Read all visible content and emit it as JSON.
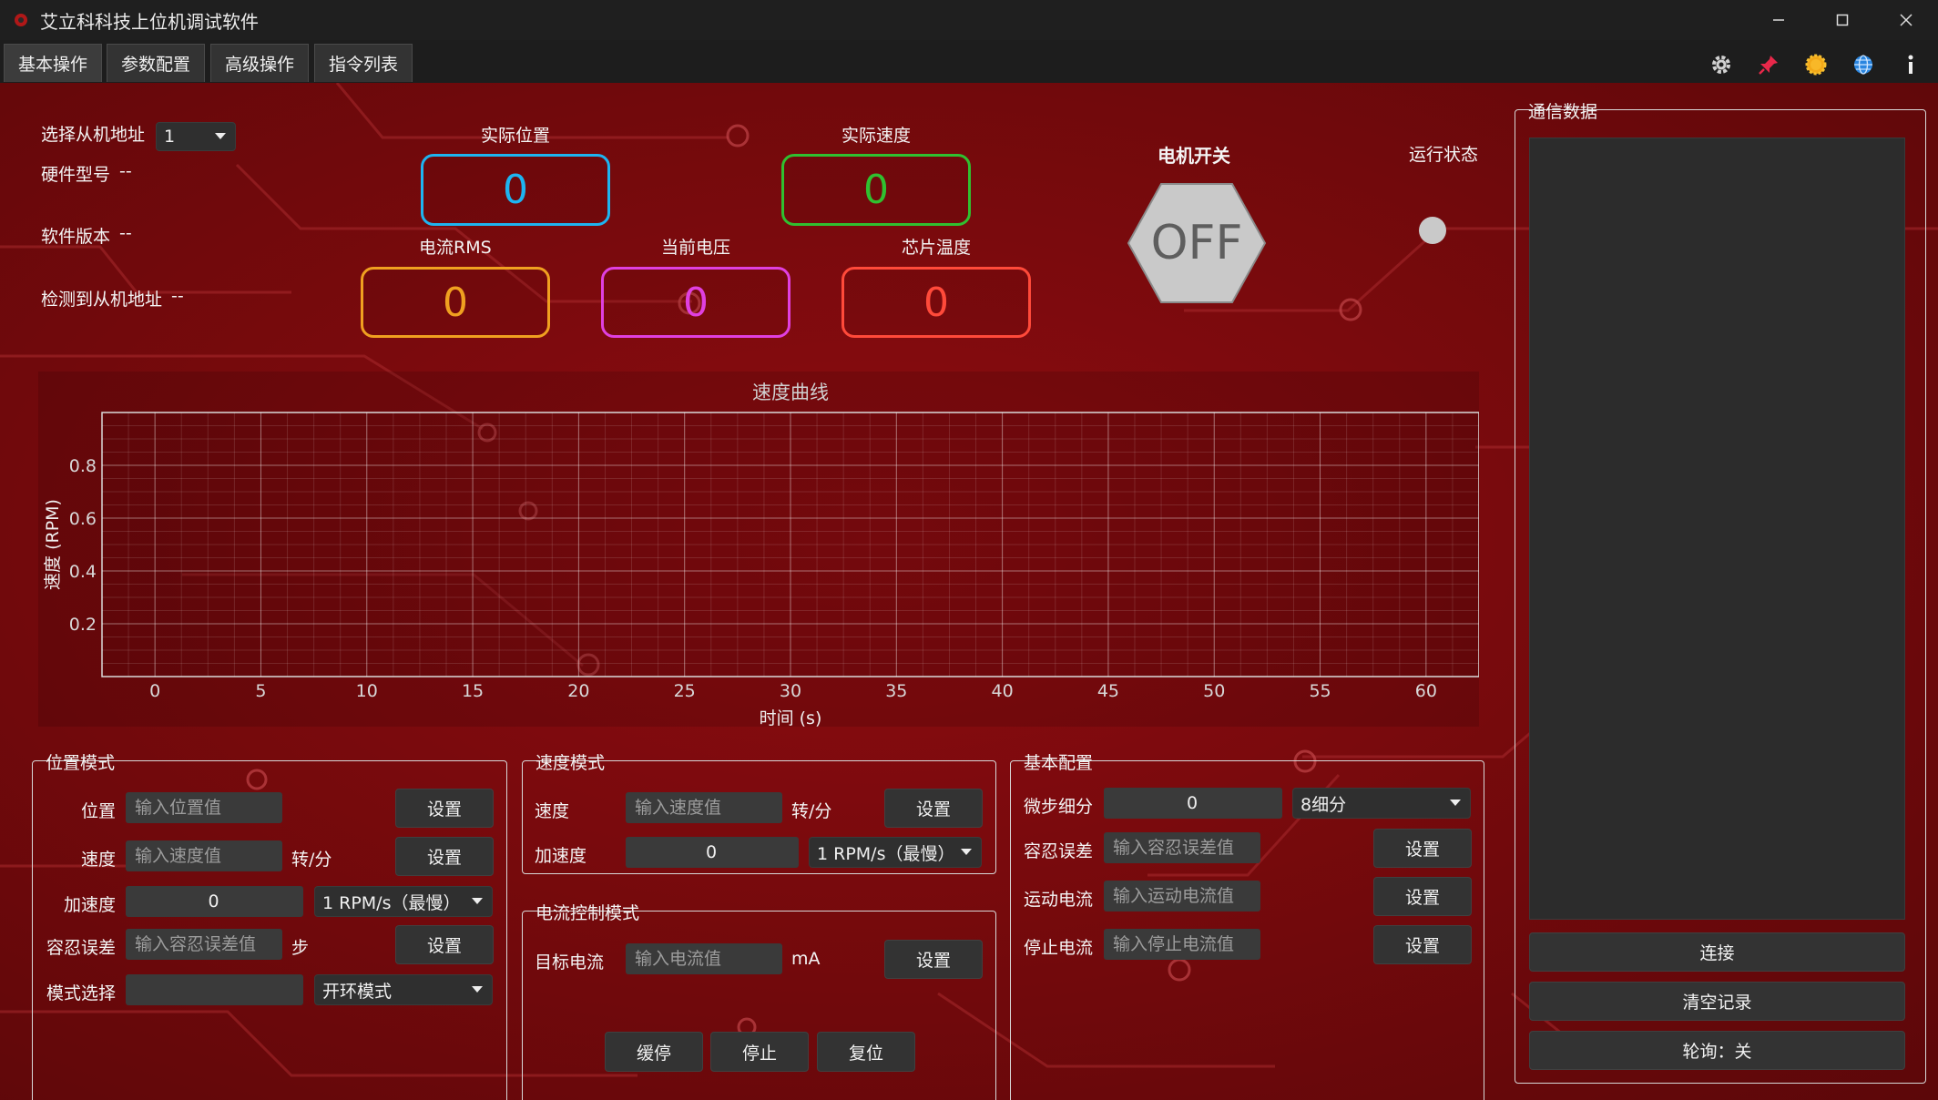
{
  "window": {
    "title": "艾立科科技上位机调试软件"
  },
  "tabs": [
    "基本操作",
    "参数配置",
    "高级操作",
    "指令列表"
  ],
  "info": {
    "slave_select_label": "选择从机地址",
    "slave_select_value": "1",
    "hardware_label": "硬件型号",
    "hardware_value": "--",
    "software_label": "软件版本",
    "software_value": "--",
    "detected_label": "检测到从机地址",
    "detected_value": "--"
  },
  "readouts": {
    "actual_position": {
      "label": "实际位置",
      "value": "0",
      "color": "#1eb4f0"
    },
    "actual_speed": {
      "label": "实际速度",
      "value": "0",
      "color": "#30c030"
    },
    "current_rms": {
      "label": "电流RMS",
      "value": "0",
      "color": "#f0a020"
    },
    "voltage": {
      "label": "当前电压",
      "value": "0",
      "color": "#e040e0"
    },
    "chip_temp": {
      "label": "芯片温度",
      "value": "0",
      "color": "#ff4a3a"
    }
  },
  "motor": {
    "switch_label": "电机开关",
    "switch_state": "OFF",
    "run_state_label": "运行状态"
  },
  "chart_data": {
    "type": "line",
    "title": "速度曲线",
    "xlabel": "时间 (s)",
    "ylabel": "速度 (RPM)",
    "xlim": [
      -2.5,
      62.5
    ],
    "ylim": [
      0,
      1
    ],
    "x_ticks": [
      0,
      5,
      10,
      15,
      20,
      25,
      30,
      35,
      40,
      45,
      50,
      55,
      60
    ],
    "y_ticks": [
      0.2,
      0.4,
      0.6,
      0.8
    ],
    "grid": true,
    "series": []
  },
  "position_mode": {
    "title": "位置模式",
    "position_label": "位置",
    "position_placeholder": "输入位置值",
    "speed_label": "速度",
    "speed_placeholder": "输入速度值",
    "speed_unit": "转/分",
    "accel_label": "加速度",
    "accel_value": "0",
    "accel_option": "1 RPM/s（最慢）",
    "tolerance_label": "容忍误差",
    "tolerance_placeholder": "输入容忍误差值",
    "tolerance_unit": "步",
    "mode_label": "模式选择",
    "mode_option": "开环模式",
    "set_label": "设置"
  },
  "speed_mode": {
    "title": "速度模式",
    "speed_label": "速度",
    "speed_placeholder": "输入速度值",
    "speed_unit": "转/分",
    "accel_label": "加速度",
    "accel_value": "0",
    "accel_option": "1 RPM/s（最慢）",
    "set_label": "设置"
  },
  "current_mode": {
    "title": "电流控制模式",
    "target_label": "目标电流",
    "target_placeholder": "输入电流值",
    "target_unit": "mA",
    "set_label": "设置"
  },
  "basic_config": {
    "title": "基本配置",
    "microstep_label": "微步细分",
    "microstep_value": "0",
    "microstep_option": "8细分",
    "tolerance_label": "容忍误差",
    "tolerance_placeholder": "输入容忍误差值",
    "run_current_label": "运动电流",
    "run_current_placeholder": "输入运动电流值",
    "stop_current_label": "停止电流",
    "stop_current_placeholder": "输入停止电流值",
    "set_label": "设置"
  },
  "actions": {
    "slow_stop": "缓停",
    "stop": "停止",
    "reset": "复位"
  },
  "comm": {
    "title": "通信数据",
    "connect": "连接",
    "clear": "清空记录",
    "poll": "轮询：关"
  },
  "icons": [
    "gear-icon",
    "pin-icon",
    "sun-icon",
    "globe-icon",
    "info-icon"
  ]
}
